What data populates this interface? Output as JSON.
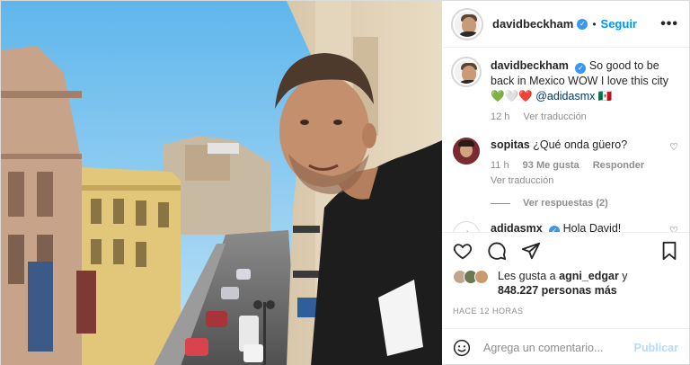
{
  "header": {
    "username": "davidbeckham",
    "separator": "•",
    "follow_label": "Seguir",
    "more_icon": "more-options-icon"
  },
  "caption": {
    "username": "davidbeckham",
    "text": "So good to be back in Mexico WOW I love this city",
    "emojis": "💚🤍❤️",
    "mention": "@adidasmx",
    "flag": "🇲🇽",
    "time": "12 h",
    "translate_label": "Ver traducción"
  },
  "comments": [
    {
      "username": "sopitas",
      "text": "¿Qué onda güero?",
      "time": "11 h",
      "likes": "93 Me gusta",
      "reply_label": "Responder",
      "translate_label": "Ver traducción",
      "view_replies": "Ver respuestas (2)"
    },
    {
      "username": "adidasmx",
      "text": "Hola David! Welcome"
    }
  ],
  "actions": {
    "like_icon": "heart-icon",
    "comment_icon": "comment-icon",
    "share_icon": "share-icon",
    "save_icon": "bookmark-icon"
  },
  "likes": {
    "prefix": "Les gusta a",
    "user": "agni_edgar",
    "conj": "y",
    "count": "848.227 personas más"
  },
  "timestamp": "HACE 12 HORAS",
  "composer": {
    "placeholder": "Agrega un comentario...",
    "post_label": "Publicar",
    "emoji_icon": "smiley-icon"
  },
  "colors": {
    "accent": "#0095f6",
    "verified": "#3897f0",
    "muted": "#8e8e8e",
    "post_disabled": "#b3dbff"
  }
}
